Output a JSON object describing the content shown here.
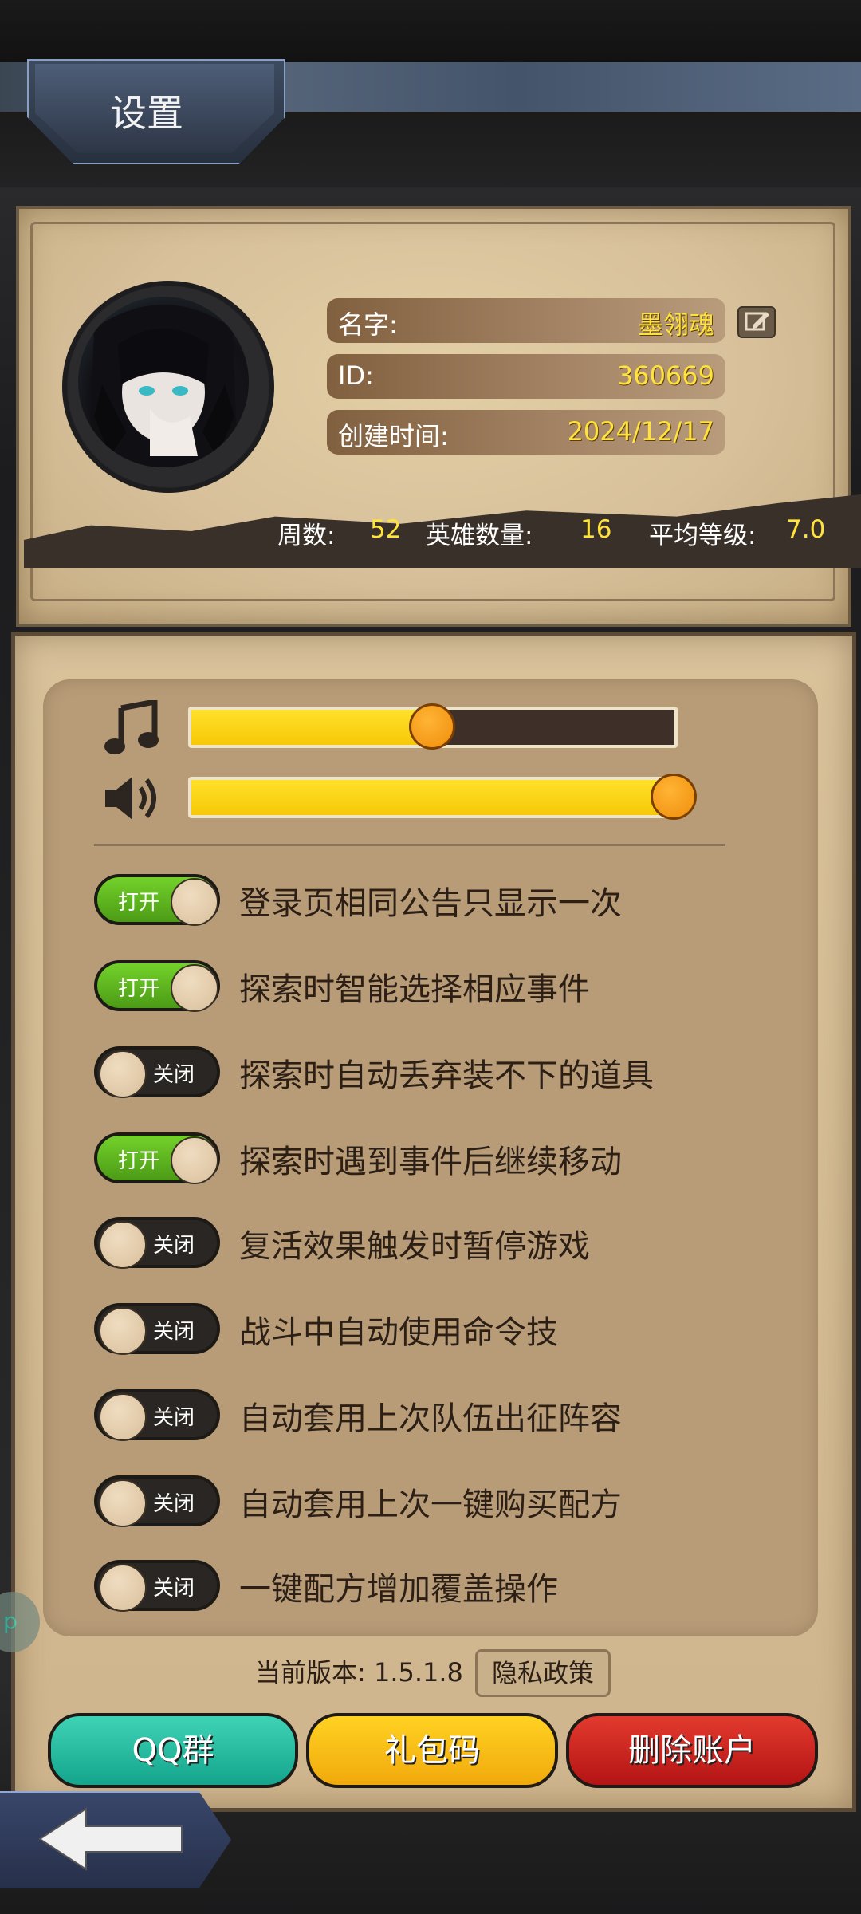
{
  "header": {
    "title": "设置"
  },
  "profile": {
    "name_label": "名字:",
    "name_value": "墨翎魂",
    "id_label": "ID:",
    "id_value": "360669",
    "created_label": "创建时间:",
    "created_value": "2024/12/17"
  },
  "stats": {
    "weeks_label": "周数:",
    "weeks_value": "52",
    "heroes_label": "英雄数量:",
    "heroes_value": "16",
    "avg_level_label": "平均等级:",
    "avg_level_value": "7.0"
  },
  "volume": {
    "music_level": 0.5,
    "sound_level": 1.0
  },
  "options": [
    {
      "state_label": "打开",
      "label": "登录页相同公告只显示一次",
      "on": true
    },
    {
      "state_label": "打开",
      "label": "探索时智能选择相应事件",
      "on": true
    },
    {
      "state_label": "关闭",
      "label": "探索时自动丢弃装不下的道具",
      "on": false
    },
    {
      "state_label": "打开",
      "label": "探索时遇到事件后继续移动",
      "on": true
    },
    {
      "state_label": "关闭",
      "label": "复活效果触发时暂停游戏",
      "on": false
    },
    {
      "state_label": "关闭",
      "label": "战斗中自动使用命令技",
      "on": false
    },
    {
      "state_label": "关闭",
      "label": "自动套用上次队伍出征阵容",
      "on": false
    },
    {
      "state_label": "关闭",
      "label": "自动套用上次一键购买配方",
      "on": false
    },
    {
      "state_label": "关闭",
      "label": "一键配方增加覆盖操作",
      "on": false
    }
  ],
  "footer": {
    "version_text": "当前版本: 1.5.1.8",
    "privacy_label": "隐私政策",
    "qq_label": "QQ群",
    "gift_label": "礼包码",
    "delete_label": "删除账户"
  },
  "side_badge": "p",
  "colors": {
    "toggle_on": "#5bb81f",
    "slider_fill": "#ffd814",
    "value_yellow": "#ffe23b"
  }
}
